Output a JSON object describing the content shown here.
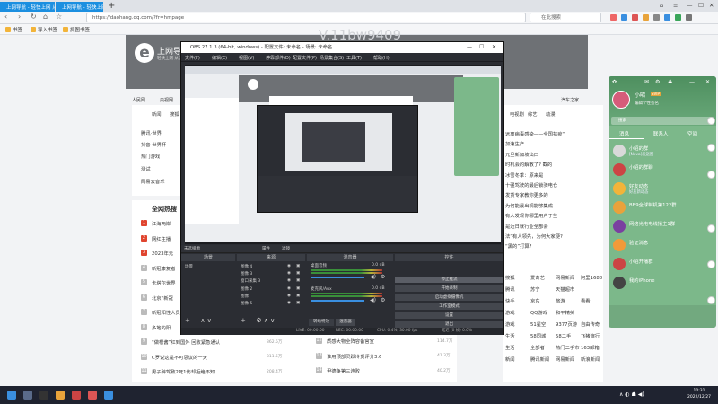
{
  "browser": {
    "tabs": [
      {
        "label": "上网导航 - 轻快上网 从这里开始"
      },
      {
        "label": "上网导航 - 轻快上网 从这里开始"
      }
    ],
    "new_tab": "+",
    "url": "https://daohang.qq.com/?fr=hmpage",
    "search_placeholder": "在此搜索",
    "bookmarks": [
      "书签",
      "导入书签",
      "抓图书签"
    ]
  },
  "hao": {
    "logo_letter": "e",
    "logo_title": "上网导航",
    "logo_subtitle": "轻快上网 从这里开始",
    "watermark": "V.11bw9409",
    "top_menu": [
      "人民网",
      "央视网"
    ],
    "top_menu_right": [
      "汽车之家"
    ],
    "tab_row": [
      "新闻",
      "搜狐"
    ],
    "tab_row_right": [
      "电视剧",
      "综艺",
      "动漫"
    ],
    "left_list": [
      "腾讯·世界",
      "抖音·世界杯",
      "热门游戏",
      "测试",
      "网易云音乐"
    ],
    "hot_title": "全网热搜",
    "hot_list": [
      {
        "n": "1",
        "t": "江海两岸",
        "h": ""
      },
      {
        "n": "2",
        "t": "网红主播",
        "h": ""
      },
      {
        "n": "3",
        "t": "2023年元",
        "h": ""
      },
      {
        "n": "4",
        "t": "新冠康复者",
        "h": ""
      },
      {
        "n": "5",
        "t": "卡塔尔世界",
        "h": ""
      },
      {
        "n": "6",
        "t": "北京“新冠",
        "h": ""
      },
      {
        "n": "7",
        "t": "新冠阳性人员",
        "h": ""
      },
      {
        "n": "8",
        "t": "多地的阳",
        "h": ""
      },
      {
        "n": "9",
        "t": "“做根酱”红到国外 回收紧急通认",
        "h": "362.5万"
      },
      {
        "n": "10",
        "t": "C罗说这是不可思议的一天",
        "h": "311.5万"
      },
      {
        "n": "11",
        "t": "男子醉驾致2死1伤却拒绝不知",
        "h": "208.4万"
      }
    ],
    "right_hot_list": [
      {
        "n": "12",
        "t": "质感大物全阵容备官宣",
        "h": "114.7万"
      },
      {
        "n": "13",
        "t": "谁用顶部灵跃冷觅评分3.6",
        "h": "41.3万"
      },
      {
        "n": "14",
        "t": "尹德争第三连败",
        "h": "40.2万"
      }
    ],
    "right_news": [
      "远离病毒感染——全国抗疫“",
      "加速生产",
      "元旦新加坡出口",
      "时机会的解散了? 截的",
      "冰雪冬季：原来是",
      "十强驾驶的最后锁骑电仓",
      "发货专家教你更多的",
      "为何能最出现能够集成",
      "有人发现你哪里用户于些",
      "是近日就行业全部会",
      "法”有人领先，为何大家便?",
      "“黑的”打算?"
    ],
    "right_links": [
      [
        "搜狐",
        "爱奇艺",
        "网易新闻",
        "阿里1688"
      ],
      [
        "腾讯",
        "苏宁",
        "天猫超市"
      ],
      [
        "快手",
        "京东",
        "旅游",
        "看看"
      ],
      [
        "游戏",
        "QQ游戏",
        "和平精英"
      ],
      [
        "游戏",
        "51星空",
        "9377页游",
        "自由传奇"
      ],
      [
        "生活",
        "58同城",
        "58二手",
        "飞猪旅行"
      ],
      [
        "生活",
        "全部者",
        "热门二手市",
        "163邮箱"
      ],
      [
        "新闻",
        "腾讯新闻",
        "网易新闻",
        "新浪新闻"
      ]
    ]
  },
  "obs": {
    "title": "OBS 27.1.3 (64-bit, windows) - 配置文件: 未命名 - 场景: 未命名",
    "menu": [
      "文件(F)",
      "编辑(E)",
      "视图(V)",
      "停靠部件(D)",
      "配置文件(P)",
      "场景集合(S)",
      "工具(T)",
      "帮助(H)"
    ],
    "scene_bar": "未选择源",
    "props_label": "属性",
    "filter_label": "滤镜",
    "docks": {
      "scenes": "场景",
      "sources": "来源",
      "mixer": "混音器",
      "transitions": "转场",
      "controls": "控件"
    },
    "scene_name": "场景",
    "sources": [
      "图像 4",
      "图像 3",
      "窗口采集 3",
      "图像 2",
      "图像",
      "图像 5"
    ],
    "mixer": [
      {
        "name": "桌面音频",
        "db": "0.0 dB"
      },
      {
        "name": "麦克风/Aux",
        "db": "0.0 dB"
      }
    ],
    "controls": [
      "停止推流",
      "开始录制",
      "启动虚拟摄像机",
      "工作室模式",
      "设置",
      "退出"
    ],
    "bottom_tabs": [
      "转场特效",
      "混音器"
    ],
    "status": {
      "live": "LIVE: 00:00:00",
      "rec": "REC: 00:00:00",
      "cpu": "CPU: 0.4%, 30.00 fps",
      "dropped": "延迟 (0 帧) 0.0%"
    }
  },
  "qq": {
    "name": "小昭",
    "badge": "SVIP",
    "sign": "编辑个性签名",
    "search": "搜索",
    "tabs": [
      "消息",
      "联系人",
      "空间"
    ],
    "items": [
      {
        "name": "小昭的群",
        "msg": "[Nova]发送图",
        "time": "",
        "color": "#d9d9d9"
      },
      {
        "name": "小昭的群聊",
        "msg": "",
        "time": "",
        "color": "#c44"
      },
      {
        "name": "好友动态",
        "msg": "好友新动态",
        "time": "",
        "color": "#f2b43a"
      },
      {
        "name": "BB9全球制机第122群",
        "msg": "",
        "time": "",
        "color": "#e9a23b"
      },
      {
        "name": "网络光电电线播主1群",
        "msg": "",
        "time": "",
        "color": "#7a3fa0"
      },
      {
        "name": "验证消息",
        "msg": "",
        "time": "",
        "color": "#f29a3a"
      },
      {
        "name": "小昭开播群",
        "msg": "",
        "time": "",
        "color": "#c44"
      },
      {
        "name": "我的iPhone",
        "msg": "",
        "time": "",
        "color": "#444"
      }
    ]
  },
  "taskbar": {
    "time": "10:31",
    "date": "2022/12/27"
  },
  "colors": {
    "accent": "#1c8fe0",
    "obs_bg": "#2b2d33",
    "qq_green": "#7cb88a",
    "hot_red": "#e0452f"
  }
}
